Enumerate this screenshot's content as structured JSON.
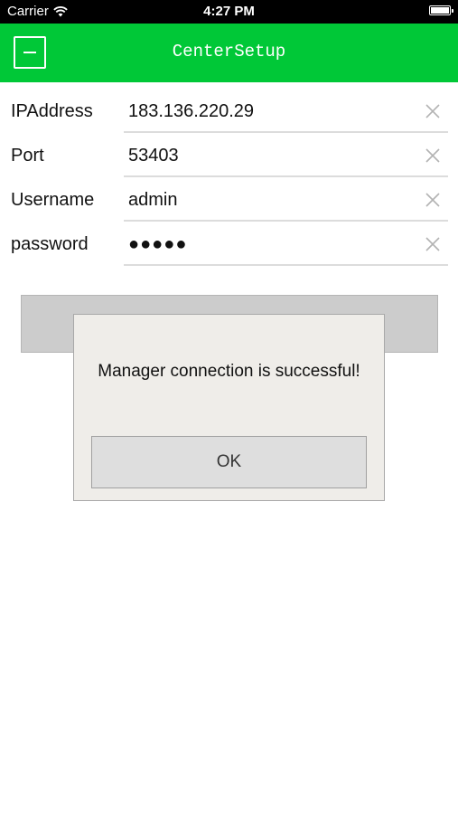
{
  "status_bar": {
    "carrier": "Carrier",
    "time": "4:27 PM",
    "icons": [
      "wifi-icon",
      "battery-icon"
    ]
  },
  "nav": {
    "title": "CenterSetup",
    "menu_icon": "menu-icon",
    "background_color": "#00c837"
  },
  "form": {
    "fields": [
      {
        "label": "IPAddress",
        "value": "183.136.220.29"
      },
      {
        "label": "Port",
        "value": "53403"
      },
      {
        "label": "Username",
        "value": "admin"
      },
      {
        "label": "password",
        "value": "●●●●●"
      }
    ],
    "clear_icon": "close-icon"
  },
  "dialog": {
    "message": "Manager connection is successful!",
    "ok_label": "OK"
  }
}
